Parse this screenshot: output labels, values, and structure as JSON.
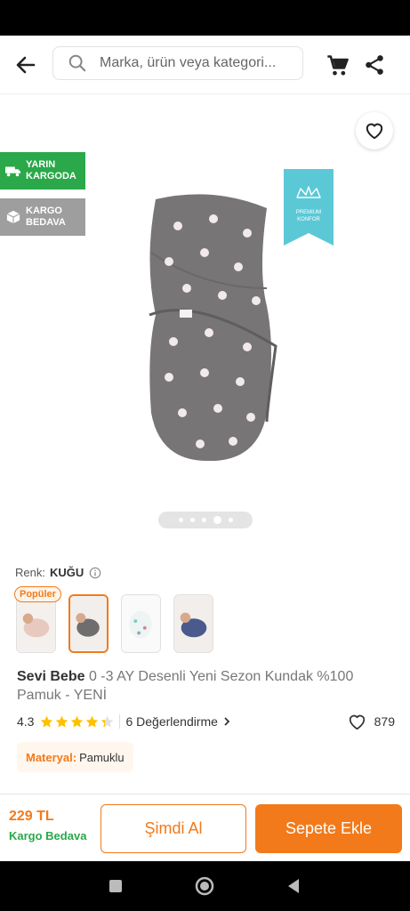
{
  "header": {
    "search_placeholder": "Marka, ürün veya kategori...",
    "icons": [
      "back-arrow-icon",
      "search-icon",
      "cart-icon",
      "share-icon"
    ]
  },
  "gallery": {
    "badges": [
      {
        "line1": "YARIN",
        "line2": "KARGODA",
        "color": "#2aa84a",
        "icon": "truck-icon"
      },
      {
        "line1": "KARGO",
        "line2": "BEDAVA",
        "color": "#9e9e9e",
        "icon": "box-icon"
      }
    ],
    "premium_line1": "PREMIUM",
    "premium_line2": "KONFOR",
    "dot_count": 5,
    "active_dot": 4
  },
  "product": {
    "color_label": "Renk:",
    "color_value": "KUĞU",
    "popular_label": "Popüler",
    "selected_thumb": 2,
    "brand": "Sevi Bebe",
    "name": "0 -3 AY Desenli Yeni Sezon Kundak %100 Pamuk - YENİ",
    "rating": "4.3",
    "rating_value": 4.3,
    "reviews_label": "6 Değerlendirme",
    "likes": "879",
    "material_key": "Materyal:",
    "material_value": "Pamuklu"
  },
  "bottom": {
    "price": "229 TL",
    "shipping": "Kargo Bedava",
    "buy_now": "Şimdi Al",
    "add_to_cart": "Sepete Ekle"
  },
  "colors": {
    "accent": "#f27a1a",
    "green": "#2aa84a",
    "teal": "#5bc8d6"
  }
}
